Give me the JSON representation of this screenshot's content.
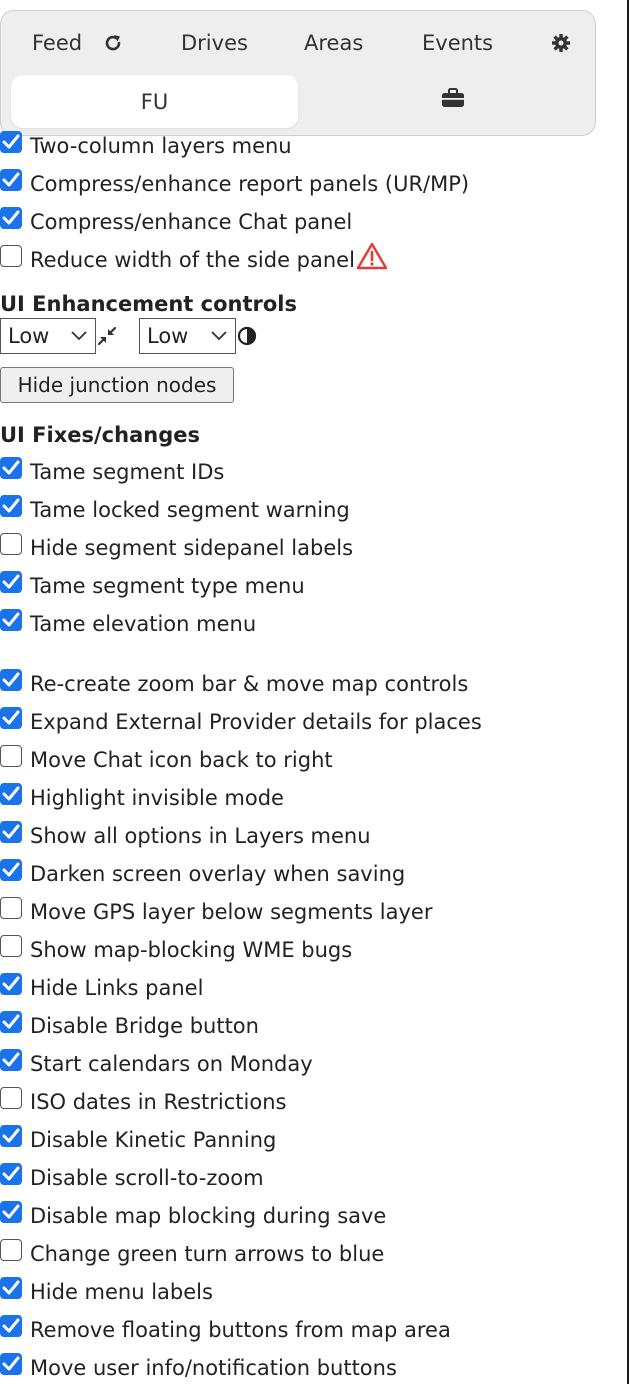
{
  "tabs": {
    "feed": "Feed",
    "drives": "Drives",
    "areas": "Areas",
    "events": "Events",
    "fu": "FU",
    "refresh_icon": "refresh-icon",
    "settings_icon": "gear-icon",
    "toolbox_icon": "briefcase-icon"
  },
  "section_top": {
    "items": [
      {
        "label": "Two-column layers menu",
        "checked": true
      },
      {
        "label": "Compress/enhance report panels (UR/MP)",
        "checked": true
      },
      {
        "label": "Compress/enhance Chat panel",
        "checked": true
      },
      {
        "label": "Reduce width of the side panel",
        "checked": false
      }
    ],
    "warning_icon": "warning-icon"
  },
  "enhancement": {
    "heading": "UI Enhancement controls",
    "compress_select": "Low",
    "contrast_select": "Low",
    "hide_junction_button": "Hide junction nodes"
  },
  "fixes": {
    "heading": "UI Fixes/changes",
    "group1": [
      {
        "label": "Tame segment IDs",
        "checked": true
      },
      {
        "label": "Tame locked segment warning",
        "checked": true
      },
      {
        "label": "Hide segment sidepanel labels",
        "checked": false
      },
      {
        "label": "Tame segment type menu",
        "checked": true
      },
      {
        "label": "Tame elevation menu",
        "checked": true
      }
    ],
    "group2": [
      {
        "label": "Re-create zoom bar & move map controls",
        "checked": true
      },
      {
        "label": "Expand External Provider details for places",
        "checked": true
      },
      {
        "label": "Move Chat icon back to right",
        "checked": false
      },
      {
        "label": "Highlight invisible mode",
        "checked": true
      },
      {
        "label": "Show all options in Layers menu",
        "checked": true
      },
      {
        "label": "Darken screen overlay when saving",
        "checked": true
      },
      {
        "label": "Move GPS layer below segments layer",
        "checked": false
      },
      {
        "label": "Show map-blocking WME bugs",
        "checked": false
      },
      {
        "label": "Hide Links panel",
        "checked": true
      },
      {
        "label": "Disable Bridge button",
        "checked": true
      },
      {
        "label": "Start calendars on Monday",
        "checked": true
      },
      {
        "label": "ISO dates in Restrictions",
        "checked": false
      },
      {
        "label": "Disable Kinetic Panning",
        "checked": true
      },
      {
        "label": "Disable scroll-to-zoom",
        "checked": true
      },
      {
        "label": "Disable map blocking during save",
        "checked": true
      },
      {
        "label": "Change green turn arrows to blue",
        "checked": false
      },
      {
        "label": "Hide menu labels",
        "checked": true
      },
      {
        "label": "Remove floating buttons from map area",
        "checked": true
      },
      {
        "label": "Move user info/notification buttons",
        "checked": true
      }
    ]
  }
}
